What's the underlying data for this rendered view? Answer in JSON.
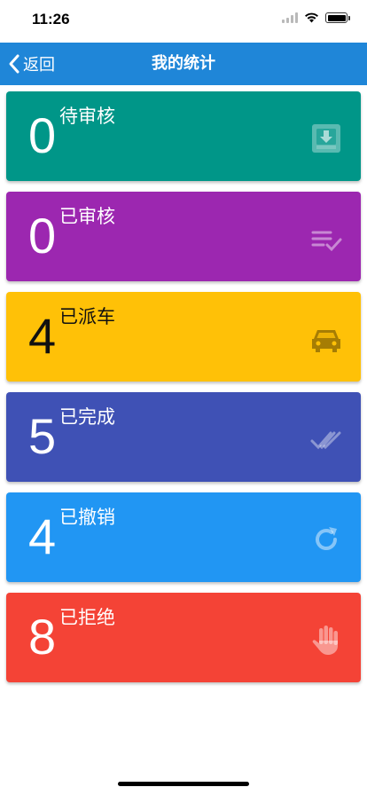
{
  "status_bar": {
    "time": "11:26"
  },
  "nav": {
    "back_label": "返回",
    "title": "我的统计"
  },
  "cards": [
    {
      "count": "0",
      "label": "待审核",
      "color": "#009688",
      "icon": "inbox-download-icon"
    },
    {
      "count": "0",
      "label": "已审核",
      "color": "#9c27b0",
      "icon": "list-check-icon"
    },
    {
      "count": "4",
      "label": "已派车",
      "color": "#ffc107",
      "icon": "car-icon"
    },
    {
      "count": "5",
      "label": "已完成",
      "color": "#3f51b5",
      "icon": "double-check-icon"
    },
    {
      "count": "4",
      "label": "已撤销",
      "color": "#2196f3",
      "icon": "refresh-icon"
    },
    {
      "count": "8",
      "label": "已拒绝",
      "color": "#f44336",
      "icon": "hand-icon"
    }
  ]
}
